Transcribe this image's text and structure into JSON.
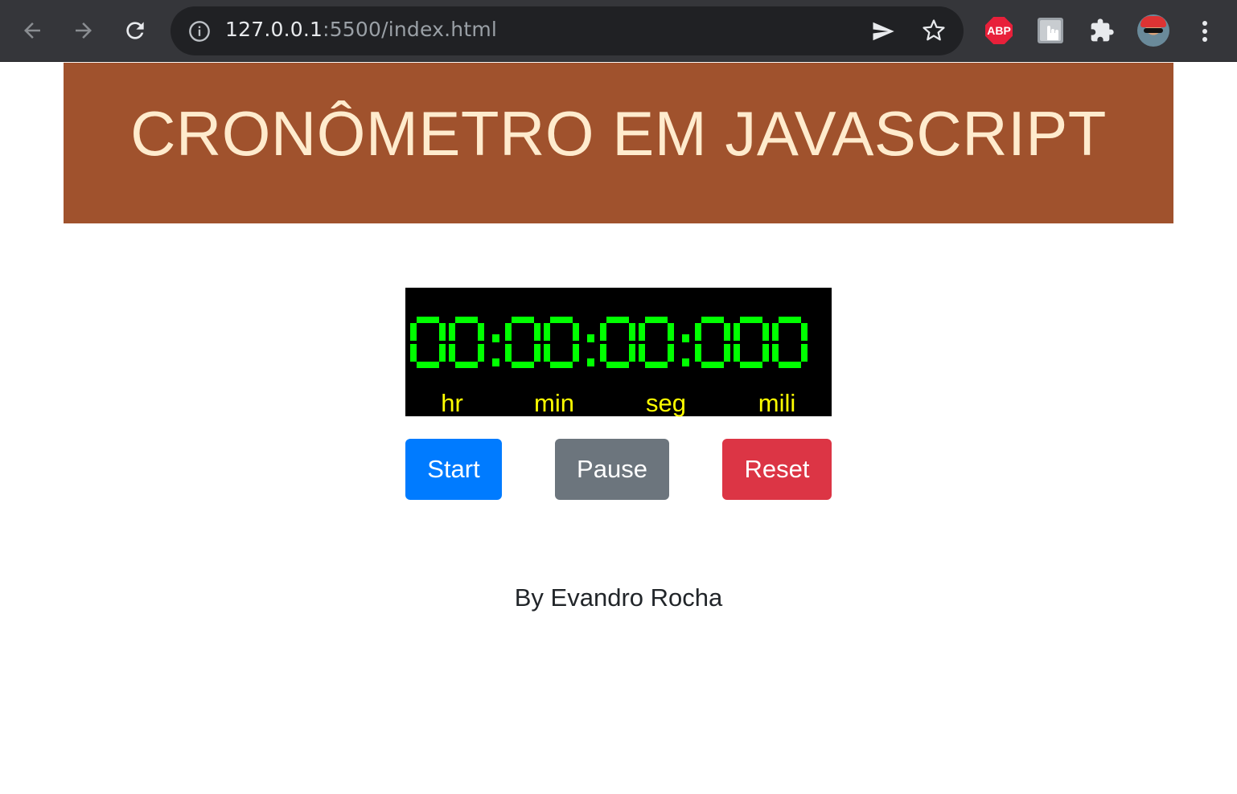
{
  "browser": {
    "url_host": "127.0.0.1",
    "url_rest": ":5500/index.html",
    "extensions": {
      "abp_label": "ABP"
    }
  },
  "header": {
    "title": "CRONÔMETRO EM JAVASCRIPT"
  },
  "stopwatch": {
    "time": "00:00:00:000",
    "labels": {
      "hours": "hr",
      "minutes": "min",
      "seconds": "seg",
      "millis": "mili"
    }
  },
  "buttons": {
    "start": "Start",
    "pause": "Pause",
    "reset": "Reset"
  },
  "footer": {
    "credit": "By Evandro Rocha"
  },
  "colors": {
    "header_bg": "#a0522d",
    "header_text": "#ffebcd",
    "display_bg": "#000000",
    "digits": "#00ff00",
    "labels": "#ffff00",
    "start": "#007bff",
    "pause": "#6c757d",
    "reset": "#dc3545"
  }
}
